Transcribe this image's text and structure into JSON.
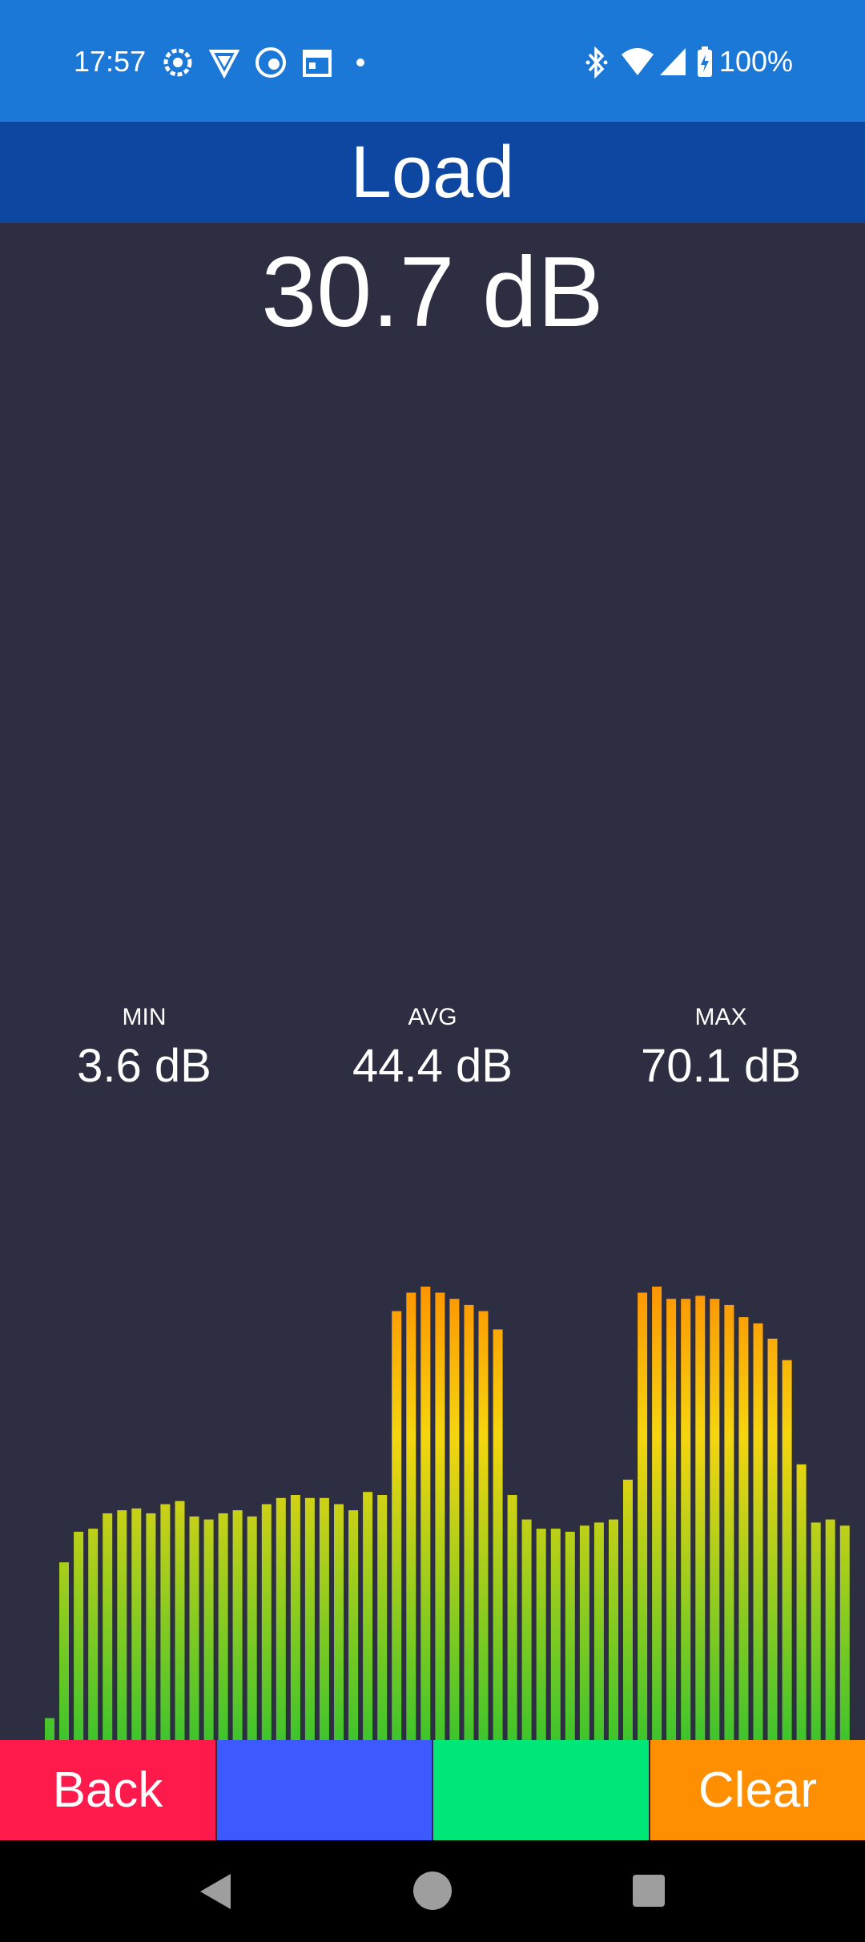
{
  "status_bar": {
    "time": "17:57",
    "left_icons": [
      "gear-notification-icon",
      "vpn-shield-icon",
      "app-notification-icon",
      "calendar-icon",
      "more-dot-icon"
    ],
    "right_icons": [
      "bluetooth-icon",
      "wifi-icon",
      "cell-signal-icon",
      "battery-charging-icon"
    ],
    "battery": "100%"
  },
  "app_bar": {
    "title": "Load"
  },
  "reading": {
    "current": "30.7 dB"
  },
  "stats": {
    "min": {
      "label": "MIN",
      "value": "3.6 dB"
    },
    "avg": {
      "label": "AVG",
      "value": "44.4 dB"
    },
    "max": {
      "label": "MAX",
      "value": "70.1 dB"
    }
  },
  "chart_data": {
    "type": "bar",
    "title": "",
    "xlabel": "",
    "ylabel": "",
    "ylim": [
      0,
      80
    ],
    "colors": {
      "low": "#3fc42c",
      "mid": "#f5d50f",
      "high": "#ff8500"
    },
    "values": [
      3.6,
      29,
      34,
      34.5,
      37,
      37.5,
      37.8,
      37,
      38.5,
      39,
      36.5,
      36,
      37,
      37.5,
      36.5,
      38.5,
      39.5,
      40,
      39.5,
      39.5,
      38.5,
      37.5,
      40.5,
      40,
      70,
      73,
      74,
      73,
      72,
      71,
      70,
      67,
      40,
      36,
      34.5,
      34.5,
      34,
      35,
      35.5,
      36,
      42.5,
      73,
      74,
      72,
      72,
      72.5,
      72,
      71,
      69,
      68,
      65.5,
      62,
      45,
      35.5,
      36,
      35
    ]
  },
  "buttons": {
    "back": "Back",
    "blue": "",
    "green": "",
    "clear": "Clear",
    "colors": {
      "back": "#fe1b4c",
      "blue": "#3d5afe",
      "green": "#00e677",
      "clear": "#ff8f00"
    }
  },
  "nav_bar": {
    "icons": [
      "back-triangle-icon",
      "home-circle-icon",
      "recents-square-icon"
    ]
  }
}
